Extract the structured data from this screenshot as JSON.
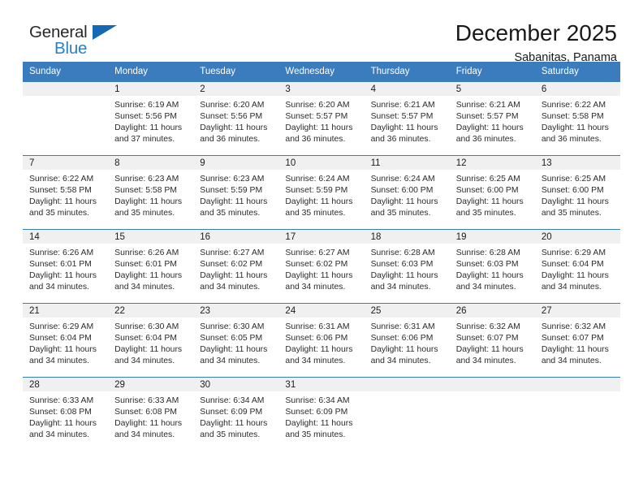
{
  "brand": {
    "name_top": "General",
    "name_bottom": "Blue",
    "color_dark": "#26282a",
    "color_blue": "#2a7fc9",
    "flag_color": "#1668b3"
  },
  "header": {
    "month_title": "December 2025",
    "location": "Sabanitas, Panama"
  },
  "calendar": {
    "header_bg": "#3a7cbe",
    "daynum_bg": "#f0f0f0",
    "weekdays": [
      "Sunday",
      "Monday",
      "Tuesday",
      "Wednesday",
      "Thursday",
      "Friday",
      "Saturday"
    ],
    "weeks": [
      [
        {
          "day": "",
          "sunrise": "",
          "sunset": "",
          "daylight": ""
        },
        {
          "day": "1",
          "sunrise": "Sunrise: 6:19 AM",
          "sunset": "Sunset: 5:56 PM",
          "daylight": "Daylight: 11 hours and 37 minutes."
        },
        {
          "day": "2",
          "sunrise": "Sunrise: 6:20 AM",
          "sunset": "Sunset: 5:56 PM",
          "daylight": "Daylight: 11 hours and 36 minutes."
        },
        {
          "day": "3",
          "sunrise": "Sunrise: 6:20 AM",
          "sunset": "Sunset: 5:57 PM",
          "daylight": "Daylight: 11 hours and 36 minutes."
        },
        {
          "day": "4",
          "sunrise": "Sunrise: 6:21 AM",
          "sunset": "Sunset: 5:57 PM",
          "daylight": "Daylight: 11 hours and 36 minutes."
        },
        {
          "day": "5",
          "sunrise": "Sunrise: 6:21 AM",
          "sunset": "Sunset: 5:57 PM",
          "daylight": "Daylight: 11 hours and 36 minutes."
        },
        {
          "day": "6",
          "sunrise": "Sunrise: 6:22 AM",
          "sunset": "Sunset: 5:58 PM",
          "daylight": "Daylight: 11 hours and 36 minutes."
        }
      ],
      [
        {
          "day": "7",
          "sunrise": "Sunrise: 6:22 AM",
          "sunset": "Sunset: 5:58 PM",
          "daylight": "Daylight: 11 hours and 35 minutes."
        },
        {
          "day": "8",
          "sunrise": "Sunrise: 6:23 AM",
          "sunset": "Sunset: 5:58 PM",
          "daylight": "Daylight: 11 hours and 35 minutes."
        },
        {
          "day": "9",
          "sunrise": "Sunrise: 6:23 AM",
          "sunset": "Sunset: 5:59 PM",
          "daylight": "Daylight: 11 hours and 35 minutes."
        },
        {
          "day": "10",
          "sunrise": "Sunrise: 6:24 AM",
          "sunset": "Sunset: 5:59 PM",
          "daylight": "Daylight: 11 hours and 35 minutes."
        },
        {
          "day": "11",
          "sunrise": "Sunrise: 6:24 AM",
          "sunset": "Sunset: 6:00 PM",
          "daylight": "Daylight: 11 hours and 35 minutes."
        },
        {
          "day": "12",
          "sunrise": "Sunrise: 6:25 AM",
          "sunset": "Sunset: 6:00 PM",
          "daylight": "Daylight: 11 hours and 35 minutes."
        },
        {
          "day": "13",
          "sunrise": "Sunrise: 6:25 AM",
          "sunset": "Sunset: 6:00 PM",
          "daylight": "Daylight: 11 hours and 35 minutes."
        }
      ],
      [
        {
          "day": "14",
          "sunrise": "Sunrise: 6:26 AM",
          "sunset": "Sunset: 6:01 PM",
          "daylight": "Daylight: 11 hours and 34 minutes."
        },
        {
          "day": "15",
          "sunrise": "Sunrise: 6:26 AM",
          "sunset": "Sunset: 6:01 PM",
          "daylight": "Daylight: 11 hours and 34 minutes."
        },
        {
          "day": "16",
          "sunrise": "Sunrise: 6:27 AM",
          "sunset": "Sunset: 6:02 PM",
          "daylight": "Daylight: 11 hours and 34 minutes."
        },
        {
          "day": "17",
          "sunrise": "Sunrise: 6:27 AM",
          "sunset": "Sunset: 6:02 PM",
          "daylight": "Daylight: 11 hours and 34 minutes."
        },
        {
          "day": "18",
          "sunrise": "Sunrise: 6:28 AM",
          "sunset": "Sunset: 6:03 PM",
          "daylight": "Daylight: 11 hours and 34 minutes."
        },
        {
          "day": "19",
          "sunrise": "Sunrise: 6:28 AM",
          "sunset": "Sunset: 6:03 PM",
          "daylight": "Daylight: 11 hours and 34 minutes."
        },
        {
          "day": "20",
          "sunrise": "Sunrise: 6:29 AM",
          "sunset": "Sunset: 6:04 PM",
          "daylight": "Daylight: 11 hours and 34 minutes."
        }
      ],
      [
        {
          "day": "21",
          "sunrise": "Sunrise: 6:29 AM",
          "sunset": "Sunset: 6:04 PM",
          "daylight": "Daylight: 11 hours and 34 minutes."
        },
        {
          "day": "22",
          "sunrise": "Sunrise: 6:30 AM",
          "sunset": "Sunset: 6:04 PM",
          "daylight": "Daylight: 11 hours and 34 minutes."
        },
        {
          "day": "23",
          "sunrise": "Sunrise: 6:30 AM",
          "sunset": "Sunset: 6:05 PM",
          "daylight": "Daylight: 11 hours and 34 minutes."
        },
        {
          "day": "24",
          "sunrise": "Sunrise: 6:31 AM",
          "sunset": "Sunset: 6:06 PM",
          "daylight": "Daylight: 11 hours and 34 minutes."
        },
        {
          "day": "25",
          "sunrise": "Sunrise: 6:31 AM",
          "sunset": "Sunset: 6:06 PM",
          "daylight": "Daylight: 11 hours and 34 minutes."
        },
        {
          "day": "26",
          "sunrise": "Sunrise: 6:32 AM",
          "sunset": "Sunset: 6:07 PM",
          "daylight": "Daylight: 11 hours and 34 minutes."
        },
        {
          "day": "27",
          "sunrise": "Sunrise: 6:32 AM",
          "sunset": "Sunset: 6:07 PM",
          "daylight": "Daylight: 11 hours and 34 minutes."
        }
      ],
      [
        {
          "day": "28",
          "sunrise": "Sunrise: 6:33 AM",
          "sunset": "Sunset: 6:08 PM",
          "daylight": "Daylight: 11 hours and 34 minutes."
        },
        {
          "day": "29",
          "sunrise": "Sunrise: 6:33 AM",
          "sunset": "Sunset: 6:08 PM",
          "daylight": "Daylight: 11 hours and 34 minutes."
        },
        {
          "day": "30",
          "sunrise": "Sunrise: 6:34 AM",
          "sunset": "Sunset: 6:09 PM",
          "daylight": "Daylight: 11 hours and 35 minutes."
        },
        {
          "day": "31",
          "sunrise": "Sunrise: 6:34 AM",
          "sunset": "Sunset: 6:09 PM",
          "daylight": "Daylight: 11 hours and 35 minutes."
        },
        {
          "day": "",
          "sunrise": "",
          "sunset": "",
          "daylight": ""
        },
        {
          "day": "",
          "sunrise": "",
          "sunset": "",
          "daylight": ""
        },
        {
          "day": "",
          "sunrise": "",
          "sunset": "",
          "daylight": ""
        }
      ]
    ]
  }
}
